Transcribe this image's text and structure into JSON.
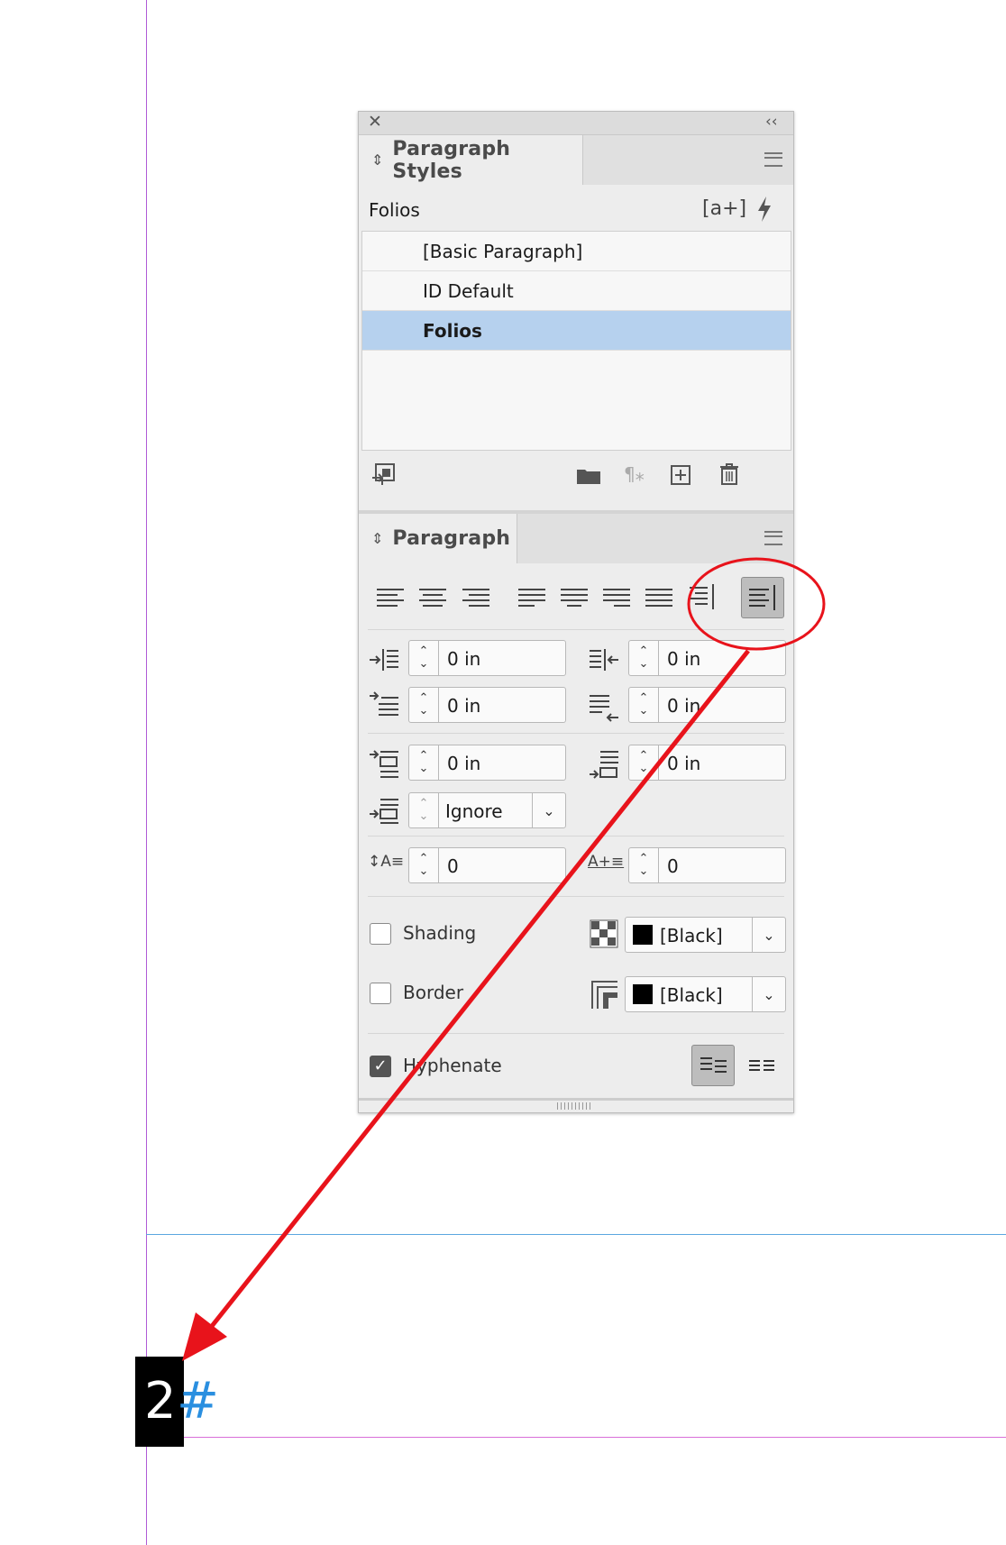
{
  "app": {
    "paragraph_styles_panel": {
      "title": "Paragraph Styles",
      "current_style": "Folios",
      "new_group_label": "[a+]",
      "styles": [
        {
          "label": "[Basic Paragraph]",
          "selected": false
        },
        {
          "label": "ID Default",
          "selected": false
        },
        {
          "label": "Folios",
          "selected": true
        }
      ]
    },
    "paragraph_panel": {
      "title": "Paragraph",
      "selected_alignment": "align-towards-spine",
      "fields": {
        "left_indent": "0 in",
        "right_indent": "0 in",
        "first_line_indent": "0 in",
        "last_line_right_indent": "0 in",
        "space_before": "0 in",
        "space_after": "0 in",
        "align_to_grid": "Ignore",
        "drop_cap_lines": "0",
        "drop_cap_chars": "0"
      },
      "shading": {
        "label": "Shading",
        "checked": false,
        "swatch": "[Black]"
      },
      "border": {
        "label": "Border",
        "checked": false,
        "swatch": "[Black]"
      },
      "hyphenate": {
        "label": "Hyphenate",
        "checked": true
      }
    }
  },
  "document": {
    "folio_number": "2",
    "hidden_char": "#"
  },
  "annotation_color": "#e8131b",
  "selection_color": "#b6d1ee",
  "guide_color": "#b05ad6"
}
